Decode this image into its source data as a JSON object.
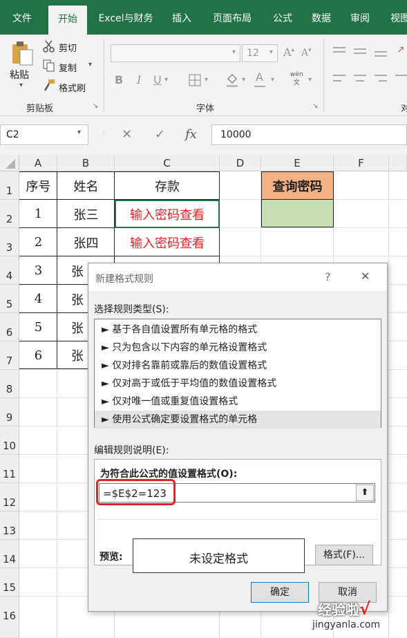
{
  "ribbon": {
    "tabs": [
      "文件",
      "开始",
      "Excel与财务",
      "插入",
      "页面布局",
      "公式",
      "数据",
      "审阅",
      "视图"
    ],
    "active_tab": "开始",
    "clipboard": {
      "paste": "粘贴",
      "cut": "剪切",
      "copy": "复制",
      "format_painter": "格式刷",
      "group_label": "剪贴板"
    },
    "font": {
      "size": "12",
      "group_label": "字体",
      "bold": "B",
      "italic": "I",
      "underline": "U",
      "font_color": "A",
      "phonetic": "wén\n文"
    },
    "align_group_label": "对"
  },
  "formula_bar": {
    "name_box": "C2",
    "fx": "fx",
    "value": "10000"
  },
  "sheet": {
    "columns": [
      "A",
      "B",
      "C",
      "D",
      "E",
      "F"
    ],
    "rows": [
      "1",
      "2",
      "3",
      "4",
      "5",
      "6",
      "7",
      "8",
      "9",
      "10",
      "11",
      "12",
      "13",
      "14",
      "15",
      "16"
    ],
    "header": {
      "seq": "序号",
      "name": "姓名",
      "deposit": "存款"
    },
    "records": [
      {
        "seq": "1",
        "name": "张三",
        "deposit": "输入密码查看"
      },
      {
        "seq": "2",
        "name": "张四",
        "deposit": "输入密码查看"
      },
      {
        "seq": "3",
        "name": "张"
      },
      {
        "seq": "4",
        "name": "张"
      },
      {
        "seq": "5",
        "name": "张"
      },
      {
        "seq": "6",
        "name": "张"
      }
    ],
    "query_label": "查询密码",
    "colors": {
      "query_header": "#f4b183",
      "query_input": "#c6e0b4",
      "masked_text": "#e8232a"
    }
  },
  "dialog": {
    "title": "新建格式规则",
    "help": "?",
    "close": "✕",
    "select_type_label": "选择规则类型(S):",
    "rule_types": [
      "► 基于各自值设置所有单元格的格式",
      "► 只为包含以下内容的单元格设置格式",
      "► 仅对排名靠前或靠后的数值设置格式",
      "► 仅对高于或低于平均值的数值设置格式",
      "► 仅对唯一值或重复值设置格式",
      "► 使用公式确定要设置格式的单元格"
    ],
    "selected_index": 5,
    "edit_label": "编辑规则说明(E):",
    "formula_label": "为符合此公式的值设置格式(O):",
    "formula": "=$E$2=123",
    "preview_label": "预览:",
    "preview_text": "未设定格式",
    "format_button": "格式(F)...",
    "ok": "确定",
    "cancel": "取消"
  },
  "watermark": {
    "site": "经验啦",
    "url": "jingyanla.com",
    "check": "√"
  }
}
